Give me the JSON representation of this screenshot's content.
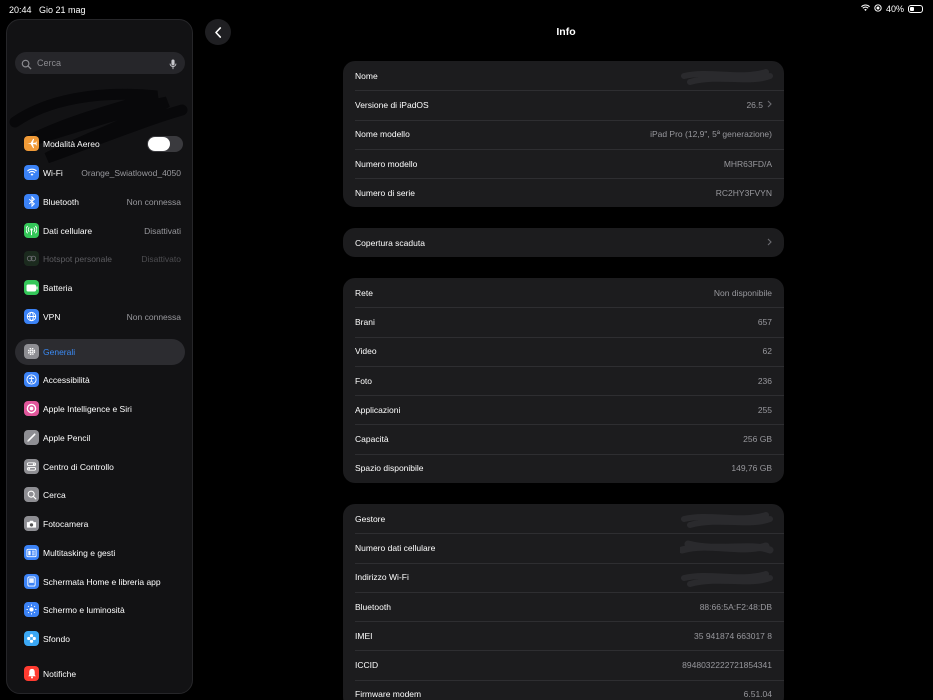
{
  "status_bar": {
    "time": "20:44",
    "date": "Gio 21 mag",
    "battery": "40%",
    "battery_level": 0.4
  },
  "sidebar": {
    "search_placeholder": "Cerca",
    "items": [
      {
        "label": "Modalità Aereo",
        "value": "",
        "icon": "airplane-icon",
        "color": "#f09a37",
        "toggle": "off"
      },
      {
        "label": "Wi-Fi",
        "value": "Orange_Swiatlowod_4050",
        "icon": "wifi-icon",
        "color": "#3b82f6"
      },
      {
        "label": "Bluetooth",
        "value": "Non connessa",
        "icon": "bluetooth-icon",
        "color": "#3b82f6"
      },
      {
        "label": "Dati cellulare",
        "value": "Disattivati",
        "icon": "cellular-icon",
        "color": "#34c759"
      },
      {
        "label": "Hotspot personale",
        "value": "Disattivato",
        "icon": "hotspot-icon",
        "color": "#34c759",
        "disabled": true
      },
      {
        "label": "Batteria",
        "value": "",
        "icon": "battery-icon",
        "color": "#34c759"
      },
      {
        "label": "VPN",
        "value": "Non connessa",
        "icon": "vpn-icon",
        "color": "#3b82f6"
      },
      {
        "label": "Generali",
        "value": "",
        "icon": "gear-icon",
        "color": "#8e8e93",
        "selected": true
      },
      {
        "label": "Accessibilità",
        "value": "",
        "icon": "accessibility-icon",
        "color": "#3b82f6"
      },
      {
        "label": "Apple Intelligence e Siri",
        "value": "",
        "icon": "siri-icon",
        "color": "#e0569b"
      },
      {
        "label": "Apple Pencil",
        "value": "",
        "icon": "pencil-icon",
        "color": "#8e8e93"
      },
      {
        "label": "Centro di Controllo",
        "value": "",
        "icon": "control-center-icon",
        "color": "#8e8e93"
      },
      {
        "label": "Cerca",
        "value": "",
        "icon": "search-icon",
        "color": "#8e8e93"
      },
      {
        "label": "Fotocamera",
        "value": "",
        "icon": "camera-icon",
        "color": "#8e8e93"
      },
      {
        "label": "Multitasking e gesti",
        "value": "",
        "icon": "multitasking-icon",
        "color": "#3b82f6"
      },
      {
        "label": "Schermata Home e libreria app",
        "value": "",
        "icon": "home-screen-icon",
        "color": "#3b82f6"
      },
      {
        "label": "Schermo e luminosità",
        "value": "",
        "icon": "brightness-icon",
        "color": "#3b82f6"
      },
      {
        "label": "Sfondo",
        "value": "",
        "icon": "wallpaper-icon",
        "color": "#3ba8f5"
      },
      {
        "label": "Notifiche",
        "value": "",
        "icon": "bell-icon",
        "color": "#ff3b30"
      }
    ]
  },
  "main": {
    "title": "Info",
    "groups": [
      [
        {
          "label": "Nome",
          "value": "",
          "redacted": true
        },
        {
          "label": "Versione di iPadOS",
          "value": "26.5",
          "chevron": true
        },
        {
          "label": "Nome modello",
          "value": "iPad Pro (12,9\", 5ª generazione)"
        },
        {
          "label": "Numero modello",
          "value": "MHR63FD/A"
        },
        {
          "label": "Numero di serie",
          "value": "RC2HY3FVYN"
        }
      ],
      [
        {
          "label": "Copertura scaduta",
          "value": "",
          "chevron": true
        }
      ],
      [
        {
          "label": "Rete",
          "value": "Non disponibile"
        },
        {
          "label": "Brani",
          "value": "657"
        },
        {
          "label": "Video",
          "value": "62"
        },
        {
          "label": "Foto",
          "value": "236"
        },
        {
          "label": "Applicazioni",
          "value": "255"
        },
        {
          "label": "Capacità",
          "value": "256 GB"
        },
        {
          "label": "Spazio disponibile",
          "value": "149,76 GB"
        }
      ],
      [
        {
          "label": "Gestore",
          "value": "",
          "redacted": true
        },
        {
          "label": "Numero dati cellulare",
          "value": "",
          "redacted": true
        },
        {
          "label": "Indirizzo Wi-Fi",
          "value": "",
          "redacted": true
        },
        {
          "label": "Bluetooth",
          "value": "88:66:5A:F2:48:DB"
        },
        {
          "label": "IMEI",
          "value": "35 941874 663017 8"
        },
        {
          "label": "ICCID",
          "value": "8948032222721854341"
        },
        {
          "label": "Firmware modem",
          "value": "6.51.04"
        }
      ]
    ]
  }
}
